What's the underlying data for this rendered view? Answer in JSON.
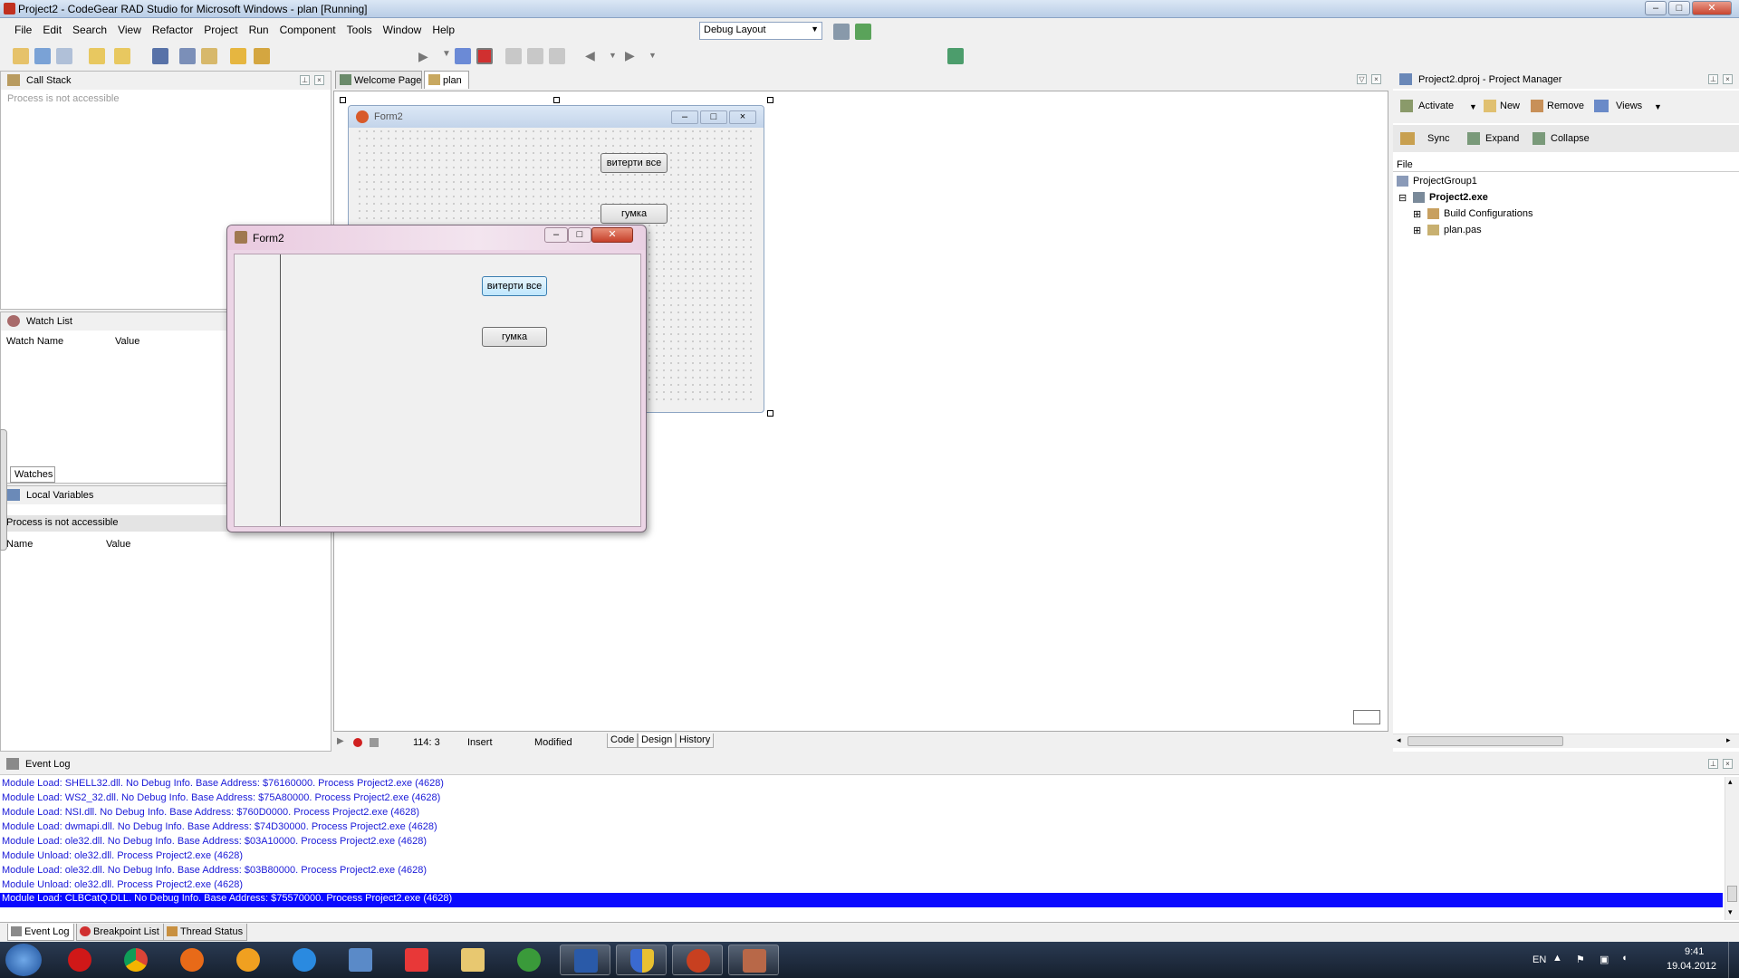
{
  "window": {
    "title": "Project2 - CodeGear RAD Studio for Microsoft Windows - plan [Running]"
  },
  "menu": [
    "File",
    "Edit",
    "Search",
    "View",
    "Refactor",
    "Project",
    "Run",
    "Component",
    "Tools",
    "Window",
    "Help"
  ],
  "layout_combo": "Debug Layout",
  "call_stack": {
    "title": "Call Stack",
    "message": "Process is not accessible"
  },
  "watch_list": {
    "title": "Watch List",
    "col_name": "Watch Name",
    "col_value": "Value",
    "tab": "Watches"
  },
  "local_vars": {
    "title": "Local Variables",
    "message": "Process is not accessible",
    "col_name": "Name",
    "col_value": "Value"
  },
  "editor_tabs": [
    "Welcome Page",
    "plan"
  ],
  "design_form": {
    "caption": "Form2",
    "btn1": "витерти все",
    "btn2": "гумка"
  },
  "running_form": {
    "caption": "Form2",
    "btn1": "витерти все",
    "btn2": "гумка"
  },
  "status": {
    "position": "114:  3",
    "mode": "Insert",
    "state": "Modified",
    "tabs": [
      "Code",
      "Design",
      "History"
    ]
  },
  "project_manager": {
    "title": "Project2.dproj - Project Manager",
    "tools1": [
      "Activate",
      "New",
      "Remove",
      "Views"
    ],
    "tools2": [
      "Sync",
      "Expand",
      "Collapse"
    ],
    "col": "File",
    "tree": [
      "ProjectGroup1",
      "Project2.exe",
      "Build Configurations",
      "plan.pas"
    ]
  },
  "event_log": {
    "title": "Event Log",
    "lines": [
      "Module Load: SHELL32.dll. No Debug Info. Base Address: $76160000. Process Project2.exe (4628)",
      "Module Load: WS2_32.dll. No Debug Info. Base Address: $75A80000. Process Project2.exe (4628)",
      "Module Load: NSI.dll. No Debug Info. Base Address: $760D0000. Process Project2.exe (4628)",
      "Module Load: dwmapi.dll. No Debug Info. Base Address: $74D30000. Process Project2.exe (4628)",
      "Module Load: ole32.dll. No Debug Info. Base Address: $03A10000. Process Project2.exe (4628)",
      "Module Unload: ole32.dll. Process Project2.exe (4628)",
      "Module Load: ole32.dll. No Debug Info. Base Address: $03B80000. Process Project2.exe (4628)",
      "Module Unload: ole32.dll. Process Project2.exe (4628)",
      "Module Load: CLBCatQ.DLL. No Debug Info. Base Address: $75570000. Process Project2.exe (4628)"
    ]
  },
  "bottom_tabs": [
    "Event Log",
    "Breakpoint List",
    "Thread Status"
  ],
  "tray": {
    "lang": "EN",
    "time": "9:41",
    "date": "19.04.2012"
  },
  "colors": {
    "selection": "#0a0aff",
    "log_text": "#1a1ad8",
    "taskbar": "#1e2b3c"
  }
}
